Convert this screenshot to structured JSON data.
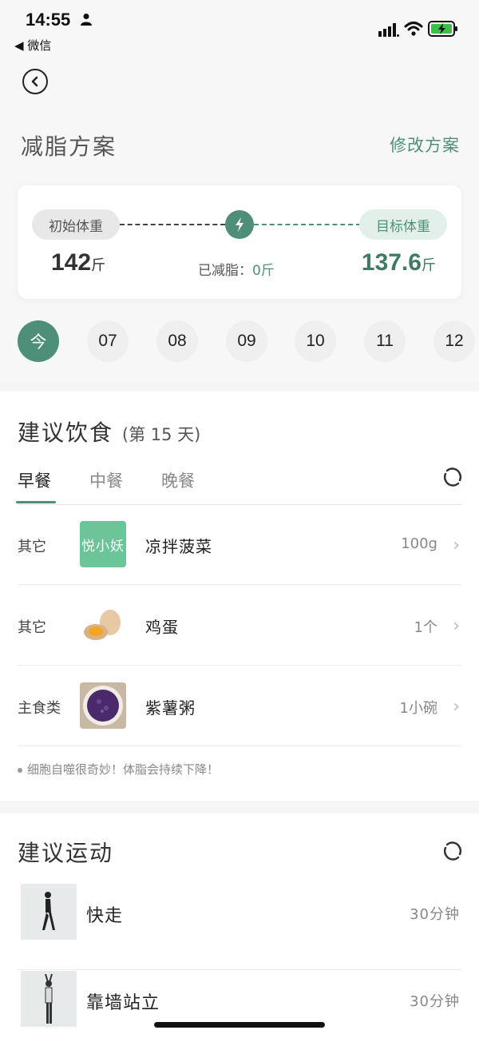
{
  "status_bar": {
    "time": "14:55",
    "back_app": "◀ 微信"
  },
  "header": {
    "title": "减脂方案",
    "edit_label": "修改方案"
  },
  "weight_card": {
    "start_label": "初始体重",
    "start_value": "142",
    "start_unit": "斤",
    "target_label": "目标体重",
    "target_value": "137.6",
    "target_unit": "斤",
    "lost_label": "已减脂：",
    "lost_value": "0斤"
  },
  "days": [
    "今",
    "07",
    "08",
    "09",
    "10",
    "11",
    "12"
  ],
  "diet": {
    "title": "建议饮食",
    "day_note": "(第 15 天)",
    "tabs": [
      "早餐",
      "中餐",
      "晚餐"
    ],
    "items": [
      {
        "category": "其它",
        "name": "凉拌菠菜",
        "quantity": "100g",
        "thumb_text": "悦小妖"
      },
      {
        "category": "其它",
        "name": "鸡蛋",
        "quantity": "1个"
      },
      {
        "category": "主食类",
        "name": "紫薯粥",
        "quantity": "1小碗"
      }
    ],
    "tip": "细胞自噬很奇妙！体脂会持续下降！"
  },
  "exercise": {
    "title": "建议运动",
    "items": [
      {
        "name": "快走",
        "duration": "30分钟"
      },
      {
        "name": "靠墙站立",
        "duration": "30分钟"
      }
    ]
  },
  "colors": {
    "accent": "#4e8f78",
    "accent_light": "#e3efe9",
    "pill_gray": "#e8e8e8"
  }
}
